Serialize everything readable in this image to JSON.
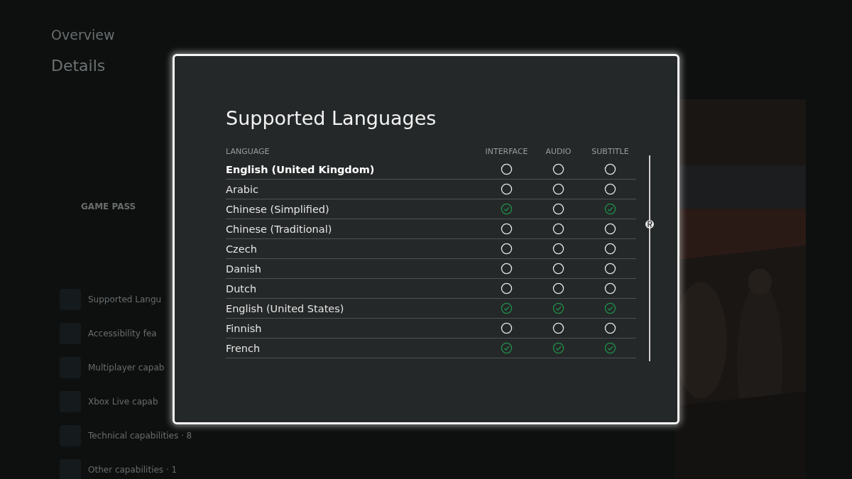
{
  "background": {
    "nav_title": "Overview",
    "heading": "Details",
    "badge": "GAME PASS",
    "items": [
      {
        "label": "Supported Langu"
      },
      {
        "label": "Accessibility fea"
      },
      {
        "label": "Multiplayer capab"
      },
      {
        "label": "Xbox Live capab"
      },
      {
        "label": "Technical capabilities · 8"
      },
      {
        "label": "Other capabilities · 1"
      }
    ]
  },
  "dialog": {
    "title": "Supported Languages",
    "columns": [
      "LANGUAGE",
      "INTERFACE",
      "AUDIO",
      "SUBTITLE"
    ],
    "rows": [
      {
        "language": "English (United Kingdom)",
        "selected": true,
        "interface": false,
        "audio": false,
        "subtitle": false
      },
      {
        "language": "Arabic",
        "selected": false,
        "interface": false,
        "audio": false,
        "subtitle": false
      },
      {
        "language": "Chinese (Simplified)",
        "selected": false,
        "interface": true,
        "audio": false,
        "subtitle": true
      },
      {
        "language": "Chinese (Traditional)",
        "selected": false,
        "interface": false,
        "audio": false,
        "subtitle": false
      },
      {
        "language": "Czech",
        "selected": false,
        "interface": false,
        "audio": false,
        "subtitle": false
      },
      {
        "language": "Danish",
        "selected": false,
        "interface": false,
        "audio": false,
        "subtitle": false
      },
      {
        "language": "Dutch",
        "selected": false,
        "interface": false,
        "audio": false,
        "subtitle": false
      },
      {
        "language": "English (United States)",
        "selected": false,
        "interface": true,
        "audio": true,
        "subtitle": true
      },
      {
        "language": "Finnish",
        "selected": false,
        "interface": false,
        "audio": false,
        "subtitle": false
      },
      {
        "language": "French",
        "selected": false,
        "interface": true,
        "audio": true,
        "subtitle": true
      }
    ]
  }
}
